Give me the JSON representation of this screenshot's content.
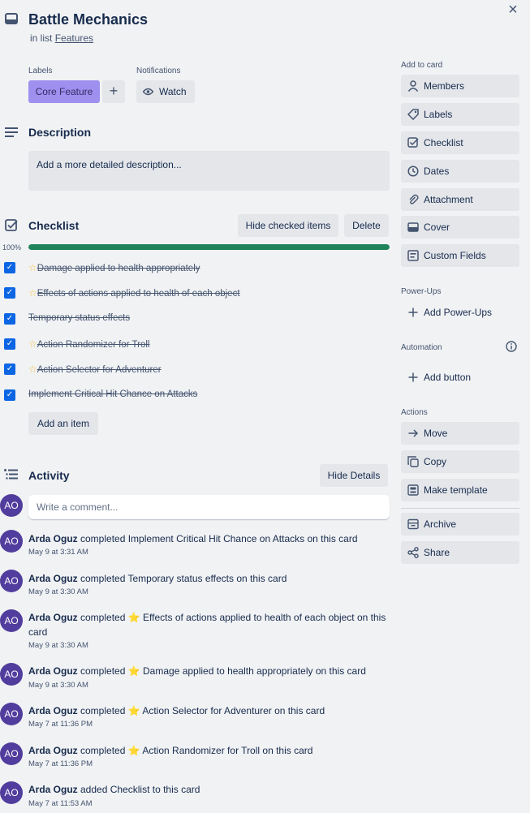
{
  "card": {
    "title": "Battle Mechanics",
    "in_list_prefix": "in list",
    "list_name": "Features"
  },
  "labels": {
    "heading": "Labels",
    "items": [
      "Core Feature"
    ],
    "add": "+"
  },
  "notifications": {
    "heading": "Notifications",
    "watch_label": "Watch"
  },
  "description": {
    "heading": "Description",
    "placeholder": "Add a more detailed description..."
  },
  "checklist": {
    "heading": "Checklist",
    "hide_checked_label": "Hide checked items",
    "delete_label": "Delete",
    "progress_text": "100%",
    "progress": 1.0,
    "items": [
      {
        "text": "Damage applied to health appropriately",
        "star": true,
        "checked": true
      },
      {
        "text": "Effects of actions applied to health of each object",
        "star": true,
        "checked": true
      },
      {
        "text": "Temporary status effects",
        "star": false,
        "checked": true
      },
      {
        "text": "Action Randomizer for Troll",
        "star": true,
        "checked": true
      },
      {
        "text": "Action Selector for Adventurer",
        "star": true,
        "checked": true
      },
      {
        "text": "Implement Critical Hit Chance on Attacks",
        "star": false,
        "checked": true
      }
    ],
    "add_item_label": "Add an item"
  },
  "activity": {
    "heading": "Activity",
    "hide_details_label": "Hide Details",
    "comment_placeholder": "Write a comment...",
    "avatar_initials": "AO",
    "entries": [
      {
        "user": "Arda Oguz",
        "text_before": " completed ",
        "star": false,
        "item": "Implement Critical Hit Chance on Attacks",
        "text_after": " on this card",
        "time": "May 9 at 3:31 AM"
      },
      {
        "user": "Arda Oguz",
        "text_before": " completed ",
        "star": false,
        "item": "Temporary status effects",
        "text_after": " on this card",
        "time": "May 9 at 3:30 AM"
      },
      {
        "user": "Arda Oguz",
        "text_before": " completed ",
        "star": true,
        "item": "Effects of actions applied to health of each object",
        "text_after": " on this card",
        "time": "May 9 at 3:30 AM"
      },
      {
        "user": "Arda Oguz",
        "text_before": " completed ",
        "star": true,
        "item": "Damage applied to health appropriately",
        "text_after": " on this card",
        "time": "May 9 at 3:30 AM"
      },
      {
        "user": "Arda Oguz",
        "text_before": " completed ",
        "star": true,
        "item": "Action Selector for Adventurer",
        "text_after": " on this card",
        "time": "May 7 at 11:36 PM"
      },
      {
        "user": "Arda Oguz",
        "text_before": " completed ",
        "star": true,
        "item": "Action Randomizer for Troll",
        "text_after": " on this card",
        "time": "May 7 at 11:36 PM"
      },
      {
        "user": "Arda Oguz",
        "text_before": " added ",
        "star": false,
        "item": "Checklist",
        "text_after": " to this card",
        "time": "May 7 at 11:53 AM"
      }
    ]
  },
  "sidebar": {
    "add_to_card_heading": "Add to card",
    "add_to_card": [
      {
        "label": "Members",
        "icon": "person-icon"
      },
      {
        "label": "Labels",
        "icon": "tag-icon"
      },
      {
        "label": "Checklist",
        "icon": "checklist-icon"
      },
      {
        "label": "Dates",
        "icon": "clock-icon"
      },
      {
        "label": "Attachment",
        "icon": "paperclip-icon"
      },
      {
        "label": "Cover",
        "icon": "cover-icon"
      },
      {
        "label": "Custom Fields",
        "icon": "custom-fields-icon"
      }
    ],
    "powerups_heading": "Power-Ups",
    "add_powerups_label": "Add Power-Ups",
    "automation_heading": "Automation",
    "add_button_label": "Add button",
    "actions_heading": "Actions",
    "actions": [
      {
        "label": "Move",
        "icon": "arrow-right-icon"
      },
      {
        "label": "Copy",
        "icon": "copy-icon"
      },
      {
        "label": "Make template",
        "icon": "template-icon"
      },
      {
        "label": "Archive",
        "icon": "archive-icon"
      },
      {
        "label": "Share",
        "icon": "share-icon"
      }
    ]
  },
  "colors": {
    "accent_blue": "#0c66e4",
    "progress_green": "#1f845a",
    "label_purple": "#9f8fef",
    "avatar_purple": "#513d9d"
  }
}
